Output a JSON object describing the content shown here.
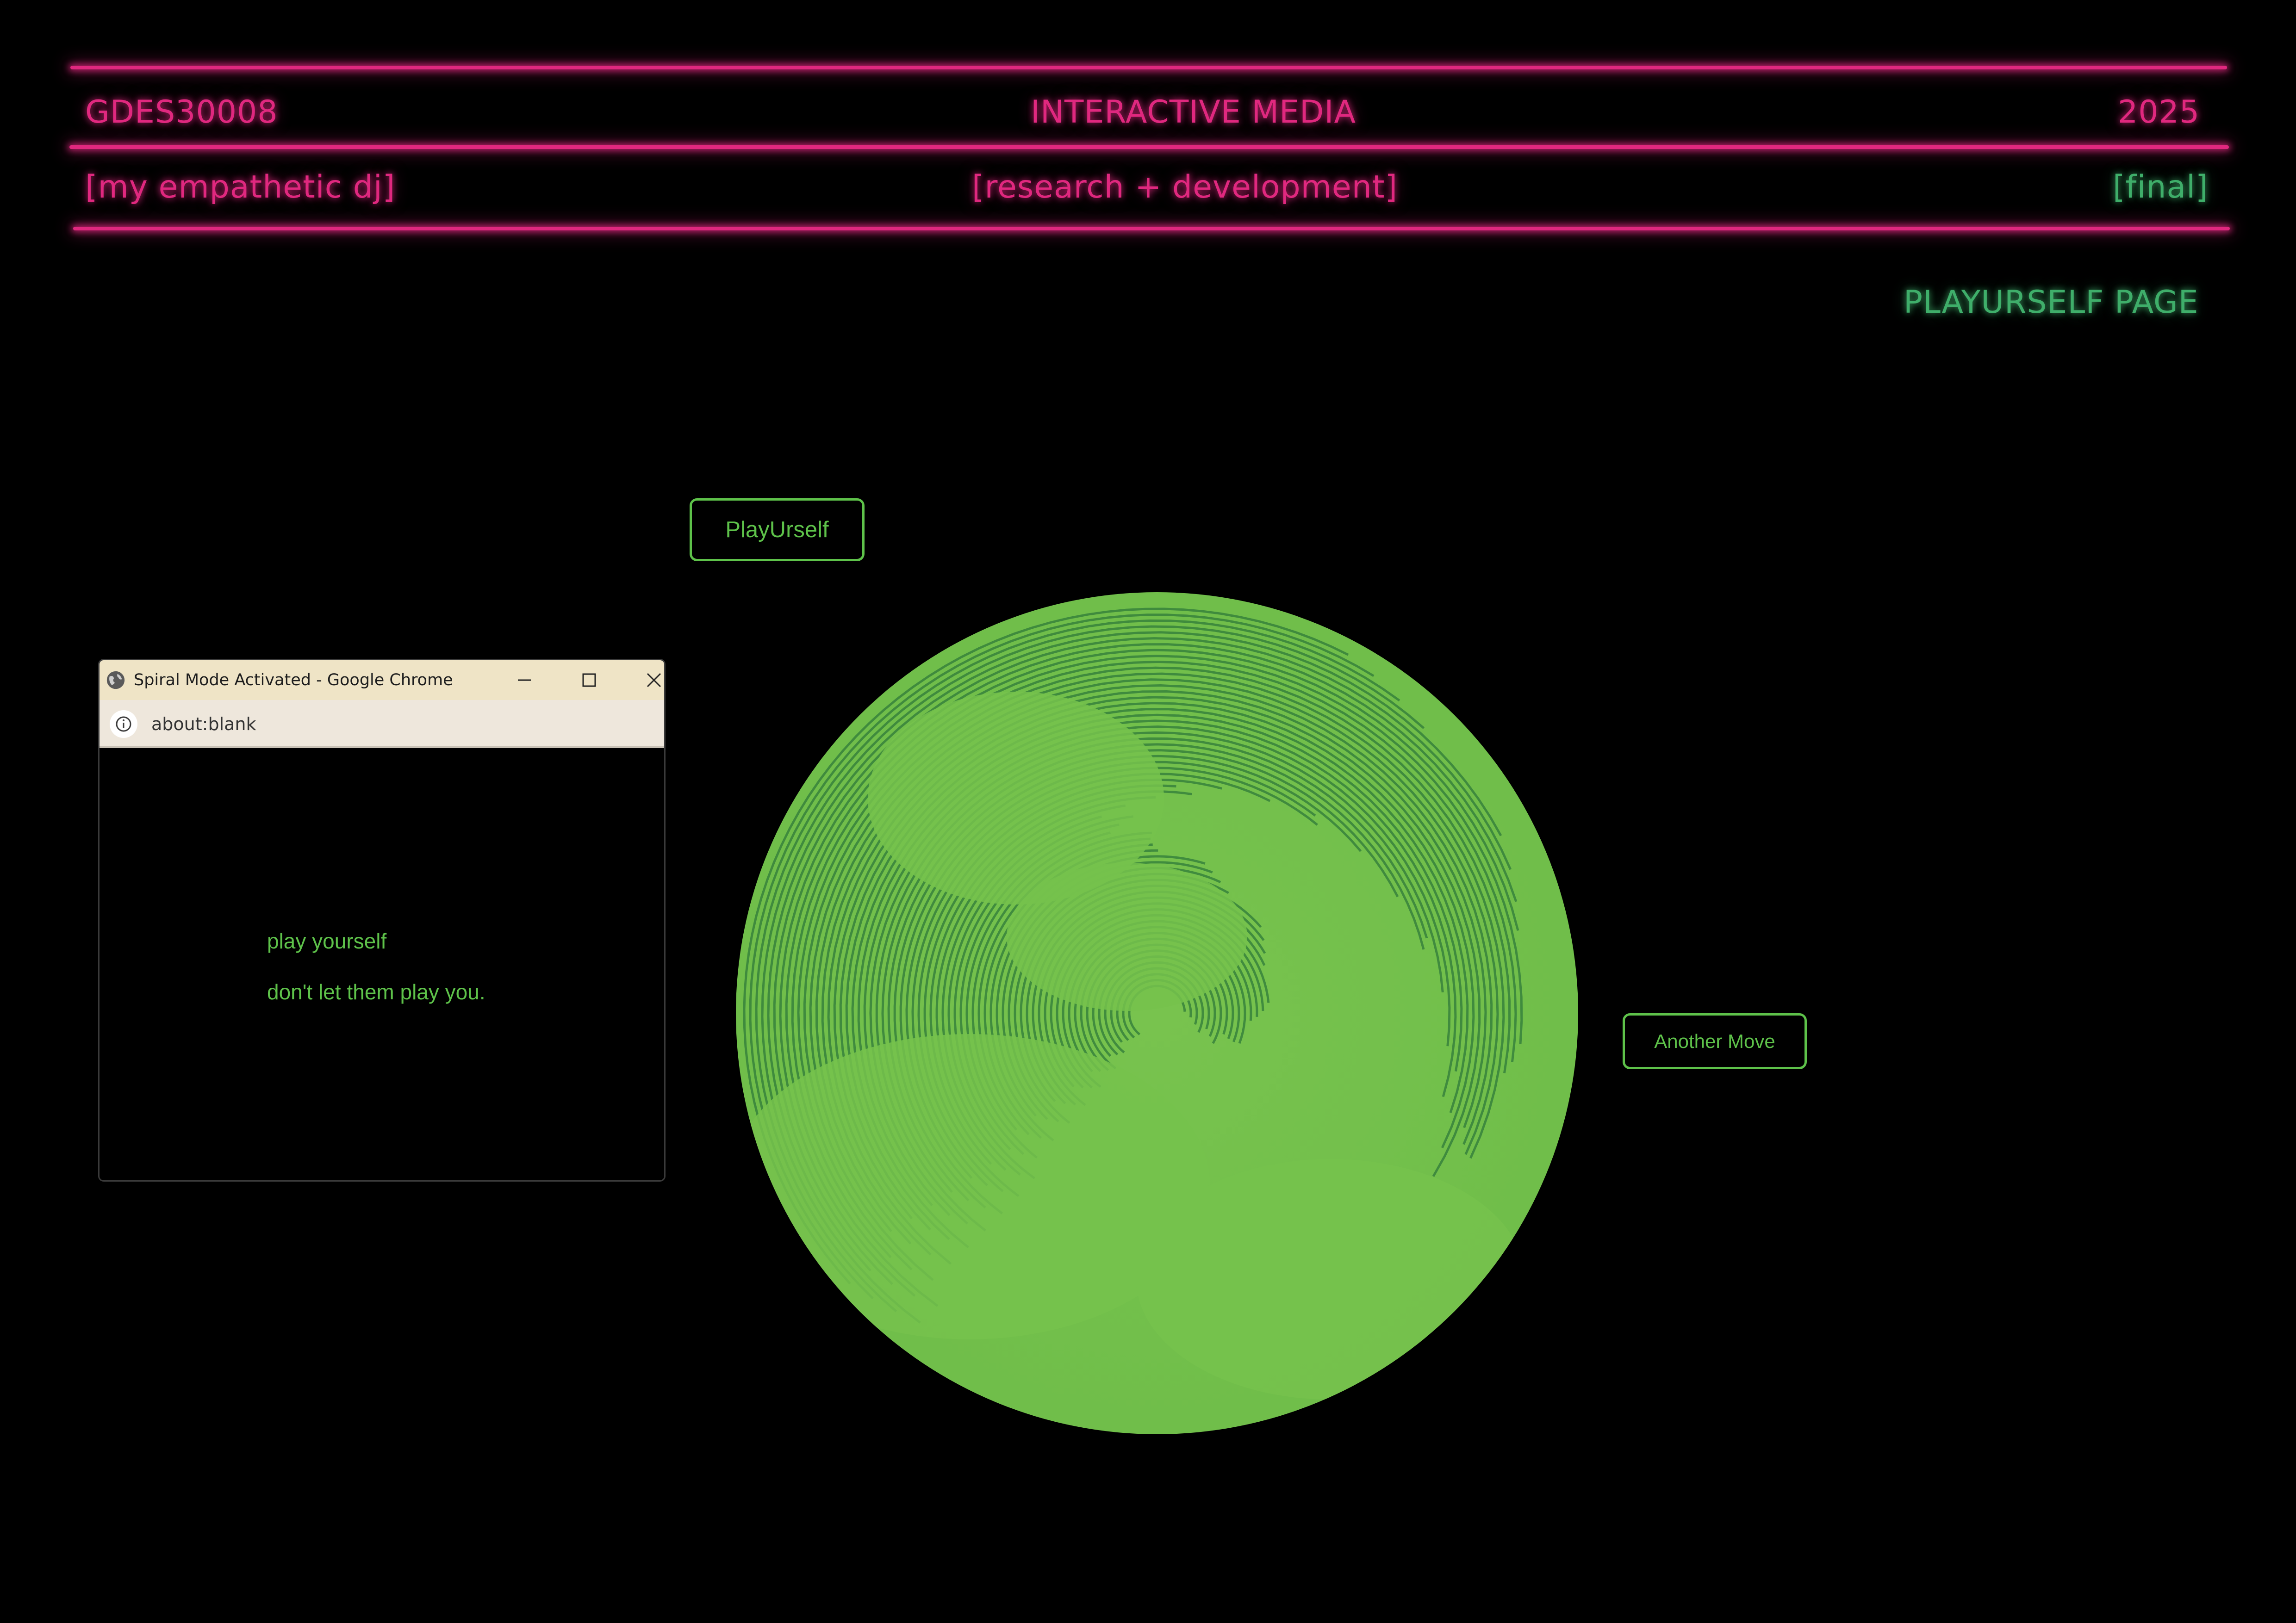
{
  "header": {
    "course_code": "GDES30008",
    "course_name": "INTERACTIVE MEDIA",
    "year": "2025",
    "project": "[my empathetic dj]",
    "stage": "[research + development]",
    "status": "[final]"
  },
  "page_label": "PLAYURSELF PAGE",
  "buttons": {
    "play_urself": "PlayUrself",
    "another_move": "Another Move"
  },
  "popup": {
    "window_title": "Spiral Mode Activated - Google Chrome",
    "url": "about:blank",
    "line1": "play yourself",
    "line2": "don't let them play you."
  },
  "colors": {
    "accent_pink": "#e0287f",
    "accent_green": "#5ec24a",
    "spiral_green": "#74c24c",
    "background": "#000000"
  },
  "icons": [
    "globe-icon",
    "minimize-icon",
    "maximize-icon",
    "close-icon",
    "info-icon"
  ]
}
